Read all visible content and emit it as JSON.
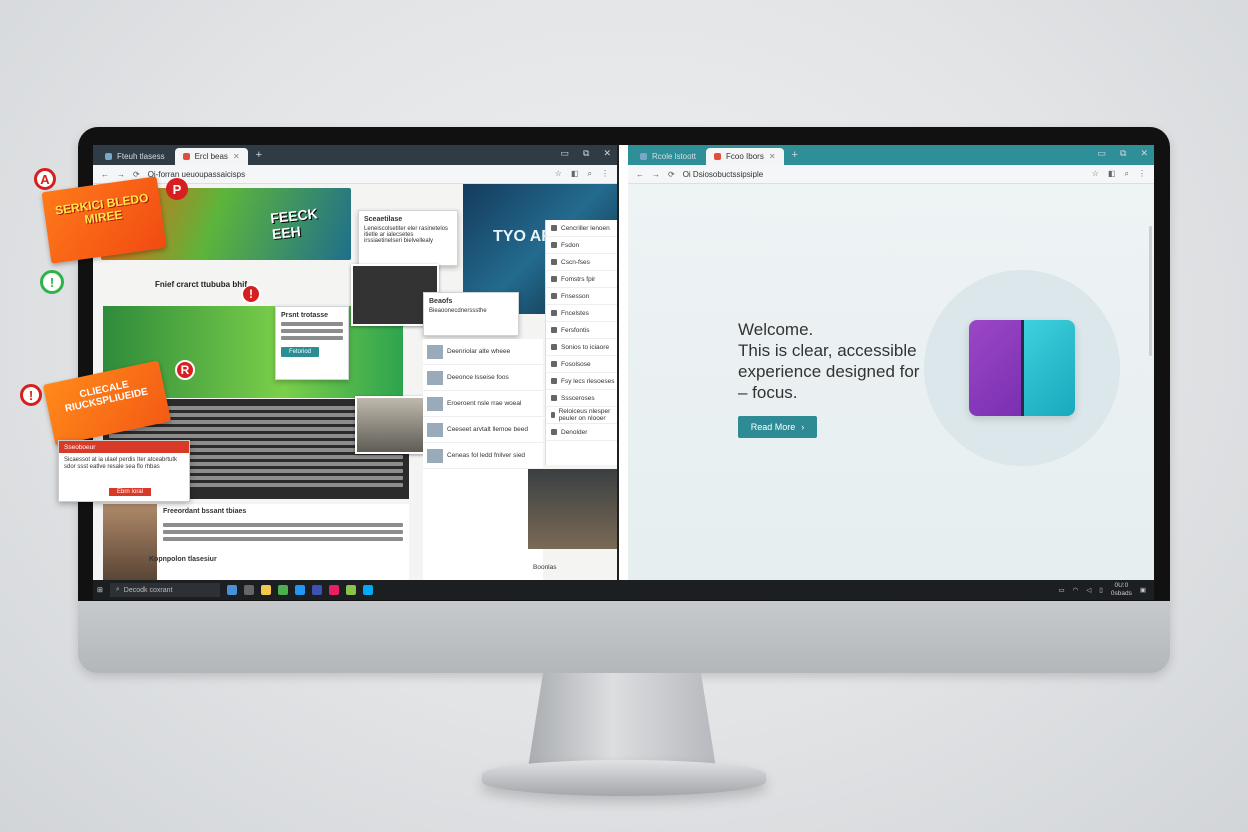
{
  "left_window": {
    "tabs": [
      {
        "label": "Fteuh tlasess"
      },
      {
        "label": "Ercl beas"
      }
    ],
    "url": "Oi-forran ueuoupassaicisps"
  },
  "right_window": {
    "tabs": [
      {
        "label": "Rcole lstoott"
      },
      {
        "label": "Fcoo Ibors"
      }
    ],
    "url": "Oi  Dsiosobuctssipsiple"
  },
  "left_content": {
    "banner_text": "FEECK EEH",
    "banner_right_text": "TYO AFOMR",
    "popup_top_title": "Sceaetilase",
    "popup_top_body": "Leneiscolsetiter eler rasinetelos itietle ar ialecsetes irssiaetinelseri bielvellealy",
    "headline": "Fnief crarct ttububa bhif",
    "popup_mid_title": "Prsnt trotasse",
    "popup_mid_button": "Fetoriod",
    "popup_news_title": "Beaofs",
    "popup_news_body": "Bieaoonecdnersssthe",
    "sidebar_items": [
      "Cencriller lenoen",
      "Fsdon",
      "Cscn-fses",
      "Fomstrs fpir",
      "Fnsesson",
      "Fncelstes",
      "Fersfontis",
      "Sonios to iciaore",
      "Fosolsose",
      "Fsy lecs rlesoeses",
      "Sssceroses",
      "Reloiceus nlesper peuler on nlooer",
      "Denolder"
    ],
    "news_items": [
      "Deenriolar alte wheee",
      "Deeonce lsseise foos",
      "Eroeroent nsle rrae woeal",
      "Ceeseet arvtalt llemoe beed",
      "Ceneas fol ledd fnilver sied"
    ],
    "article_title": "Freeordant bssant tbiaes",
    "bottom_title": "Kopnpolon tlasesiur",
    "bottom_bar_label": "Boonlas",
    "sticker_text": "SERKICI BLEDO MIREE",
    "sticker2_text": "CLIECALE RIUCKSPLIUEIDE",
    "warn_title": "Sseoboeur",
    "warn_body": "Sicaessot at ia ulael perdis Iter atceabrtutk sdor ssst eatlve resale sea flo rhbas",
    "warn_button": "Ebrn Ioral"
  },
  "right_content": {
    "welcome_line1": "Welcome.",
    "welcome_line2": "This is clear, accessible",
    "welcome_line3": "experience designed for",
    "welcome_line4": "– focus.",
    "read_more": "Read More"
  },
  "taskbar": {
    "search": "Decodk coxrant",
    "clock_top": "0U:0",
    "clock_bottom": "0sbads"
  },
  "colors": {
    "accent_teal": "#2e8a94",
    "alert_red": "#d71f1f",
    "purple": "#9b47c6",
    "cyan": "#3fd0dd"
  }
}
